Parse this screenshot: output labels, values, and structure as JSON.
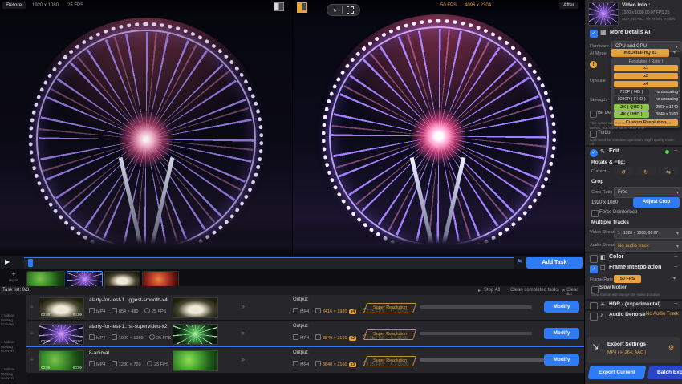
{
  "colors": {
    "accent_orange": "#E8A33D",
    "accent_blue": "#2F7BF6",
    "green_option": "#8FC74A",
    "batch_export_blue": "#2946C8"
  },
  "icons": {
    "check": "✓",
    "chevron": "▾",
    "collapse": "−",
    "expand": "+",
    "warning": "!",
    "play": "▶",
    "flag": "⚑",
    "cursor": "➤",
    "plus": "+",
    "handle": "≡",
    "arrow": "»",
    "stop": "▸",
    "trash": "✕",
    "edit": "✎",
    "ai": "▦",
    "color": "◧",
    "interp": "◫",
    "hdr": "☀",
    "mic": "♪",
    "export": "⇲",
    "sliders": "⚙",
    "rotate_left": "↺",
    "rotate_right": "↻",
    "flip": "⇆",
    "dot": "●"
  },
  "preview": {
    "before_label": "Before",
    "before_res": "1920 x 1080",
    "before_fps": "25 FPS",
    "after_fps": "50 FPS",
    "after_res": "4096 x 2304",
    "after_label": "After"
  },
  "sidebar": {
    "video_info": {
      "title": "Video Info :",
      "line1": "1920 x 1080  00:07  FPS 25",
      "line2": "SDR, No Aud. Trk, H.264, 8 Mb/s"
    },
    "more_details_label": "More Details AI",
    "hardware_label": "Hardware",
    "hardware_value": "CPU and GPU",
    "ai_model_label": "AI Model",
    "ai_model_value": "moDetail-HQ  x3",
    "upscale_label": "Upscale",
    "strength_label": "Strength",
    "dropdown": {
      "header": "Resolution ( Ratio )",
      "scale_x1": "x1",
      "scale_x2": "x2",
      "scale_x4": "x4",
      "opt_720_label": "720P ( HD )",
      "opt_720_value": "no upscaling",
      "opt_1080_label": "1080P ( FHD )",
      "opt_1080_value": "no upscaling",
      "opt_2k_label": "2K ( QHD )",
      "opt_2k_value": "2560 x 1440",
      "opt_4k_label": "4K ( UHD )",
      "opt_4k_value": "3840 x 2160",
      "custom_label": "Custom Resolution"
    },
    "bit_depth_label": "Bit Depth",
    "bit_depth_desc": "This option will improve the video quality with more details. But it also takes more time.",
    "turbo_label": "Turbo",
    "turbo_desc": "Optimized for intensive operation, slight quality trade-off.",
    "edit_label": "Edit",
    "rotate_flip_title": "Rotate & Flip:",
    "current_label": "Current",
    "crop_title": "Crop",
    "crop_ratio_label": "Crop Ratio",
    "crop_ratio_value": "Free",
    "crop_size": "1920 x 1080",
    "adjust_crop": "Adjust Crop",
    "force_deinterlace": "Force Deinterlace",
    "multiple_tracks_title": "Multiple Tracks",
    "video_stream_label": "Video Stream",
    "video_stream_value": "1 : 1920 × 1080, 00:07",
    "audio_stream_label": "Audio Stream",
    "audio_stream_value": "No audio track",
    "color_label": "Color",
    "frame_interpolation_label": "Frame Interpolation",
    "frame_rate_label": "Frame Rate",
    "frame_rate_value": "50 FPS",
    "slow_motion_label": "Slow Motion",
    "slow_motion_desc": "Slow motion will change the video duration.",
    "hdr_label": "HDR - (experimental)",
    "audio_denoise_label": "Audio Denoise",
    "audio_denoise_value": "No Audio Track",
    "export_title": "Export Settings",
    "export_subtitle": "MP4 ( H.264, AAC )",
    "export_current": "Export Current",
    "batch_export": "Batch Export"
  },
  "player": {
    "add_task": "Add Task"
  },
  "media": {
    "import_label": "import"
  },
  "tasks": {
    "header": "Task list:  0/3",
    "stop_all": "Stop All",
    "clean_completed": "Clean completed tasks",
    "clear_all": "Clear All",
    "output_label": "Output:",
    "modify": "Modify",
    "tag": "Super Resolution",
    "waiting_caption": "1 Videos Waiting Convert",
    "rows": [
      {
        "title": "alarty-for-test-1...ggest-smooth-x4",
        "in_format": "MP4",
        "in_res": "854 × 480",
        "in_fps": "25 FPS",
        "t0": "00:00",
        "t1": "00:09",
        "out_format": "MP4",
        "out_res": "3416 × 1920",
        "scale": "x4",
        "out_fps": "25 FPS",
        "out_dur": "00:09"
      },
      {
        "title": "alarty-for-test-1...st-supervideo-x2",
        "in_format": "MP4",
        "in_res": "1920 × 1080",
        "in_fps": "25 FPS",
        "t0": "00:00",
        "t1": "00:07",
        "out_format": "MP4",
        "out_res": "3840 × 2160",
        "scale": "x2",
        "out_fps": "25 FPS",
        "out_dur": "00:07"
      },
      {
        "title": "8-animal",
        "in_format": "MP4",
        "in_res": "1280 × 720",
        "in_fps": "25 FPS",
        "t0": "00:00",
        "t1": "00:09",
        "out_format": "MP4",
        "out_res": "3840 × 2160",
        "scale": "x3",
        "out_fps": "25 FPS",
        "out_dur": "00:09"
      }
    ]
  }
}
